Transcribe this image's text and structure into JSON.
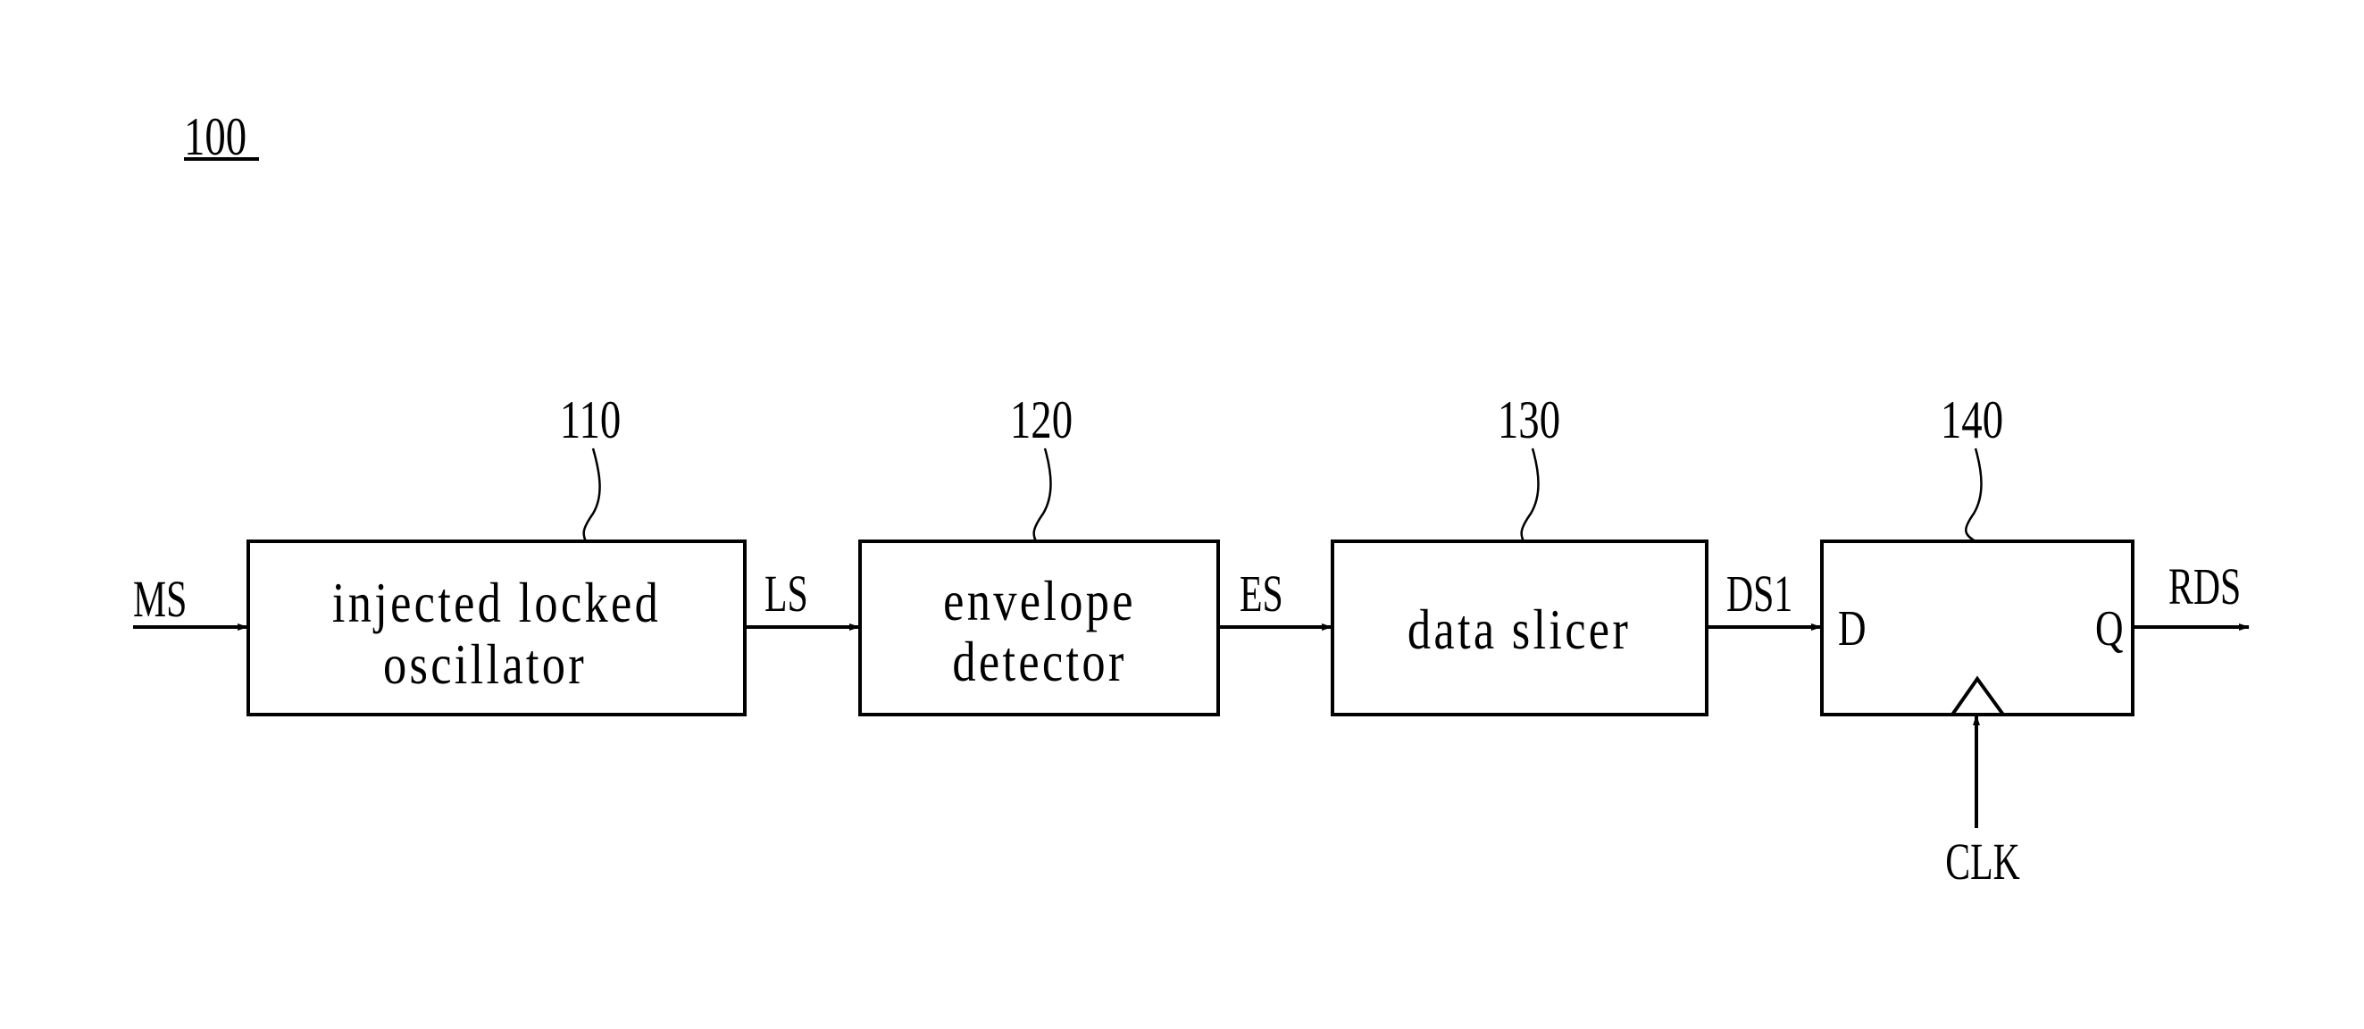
{
  "figure": {
    "ref_label": "100",
    "blocks": [
      {
        "ref": "110",
        "lines": [
          "injected locked",
          "oscillator"
        ]
      },
      {
        "ref": "120",
        "lines": [
          "envelope",
          "detector"
        ]
      },
      {
        "ref": "130",
        "lines": [
          "data slicer"
        ]
      },
      {
        "ref": "140",
        "lines": [],
        "pins": {
          "d": "D",
          "q": "Q"
        }
      }
    ],
    "signals": {
      "input": "MS",
      "s1": "LS",
      "s2": "ES",
      "s3": "DS1",
      "output": "RDS",
      "clock": "CLK"
    }
  }
}
